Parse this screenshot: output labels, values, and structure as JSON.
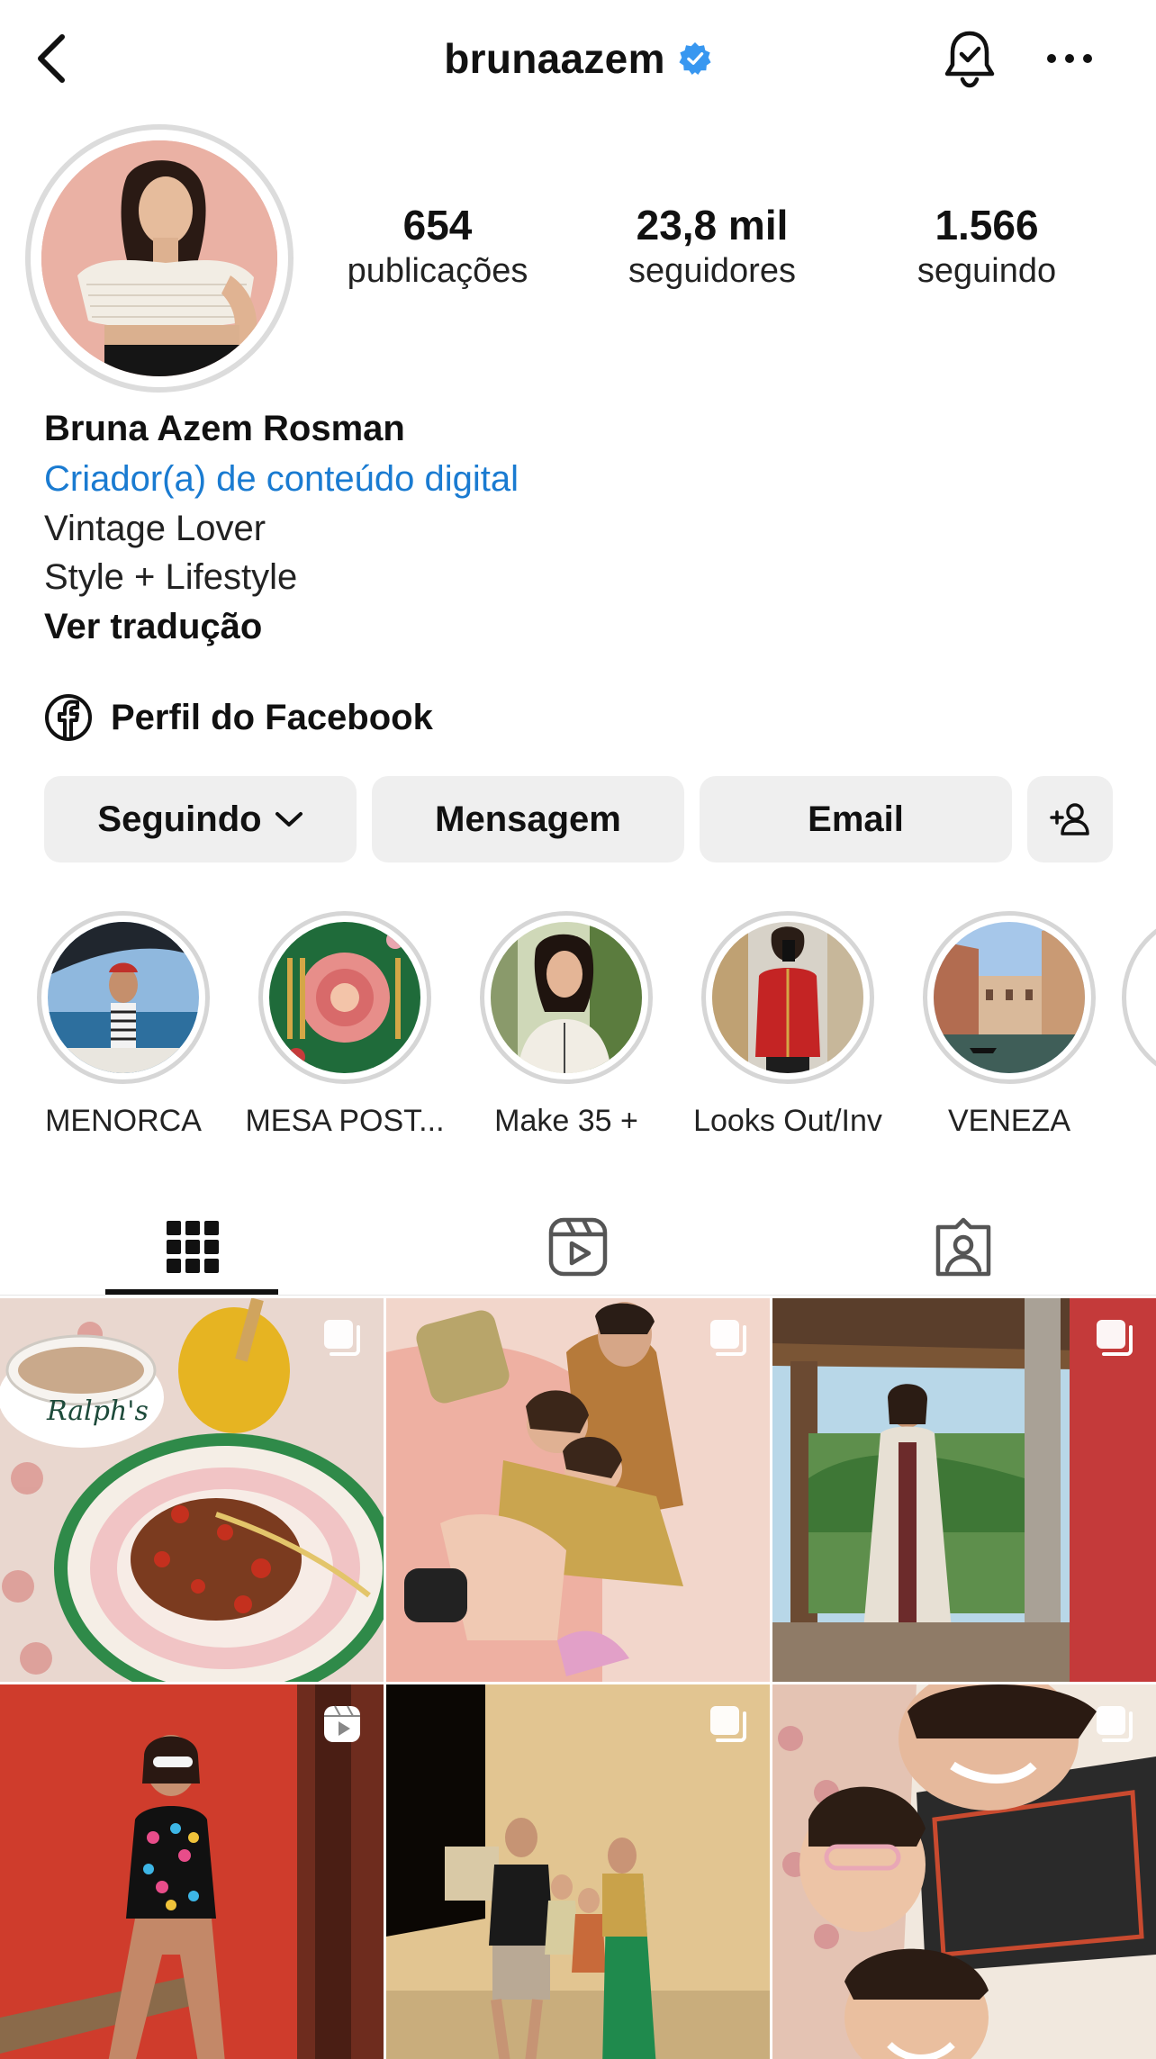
{
  "header": {
    "username": "brunaazem",
    "verified": true,
    "accent_color": "#3897f0"
  },
  "stats": [
    {
      "value": "654",
      "label": "publicações"
    },
    {
      "value": "23,8 mil",
      "label": "seguidores"
    },
    {
      "value": "1.566",
      "label": "seguindo"
    }
  ],
  "bio": {
    "name": "Bruna Azem Rosman",
    "category": "Criador(a) de conteúdo digital",
    "lines": [
      "Vintage Lover",
      "Style + Lifestyle"
    ],
    "translate": "Ver tradução",
    "category_color": "#1a7bd1"
  },
  "facebook": {
    "label": "Perfil do Facebook",
    "icon": "facebook-icon"
  },
  "actions": {
    "following": "Seguindo",
    "message": "Mensagem",
    "email": "Email",
    "add_person_icon": "add-person-icon"
  },
  "highlights": [
    {
      "label": "MENORCA"
    },
    {
      "label": "MESA POST..."
    },
    {
      "label": "Make 35 +"
    },
    {
      "label": "Looks Out/Inv"
    },
    {
      "label": "VENEZA"
    }
  ],
  "tabs": [
    {
      "name": "posts",
      "icon": "grid-icon",
      "active": true
    },
    {
      "name": "reels",
      "icon": "reels-icon",
      "active": false
    },
    {
      "name": "tagged",
      "icon": "tagged-icon",
      "active": false
    }
  ],
  "posts": [
    {
      "type": "carousel",
      "subject": "granola bowl and tea cup"
    },
    {
      "type": "carousel",
      "subject": "mother and children on sofa"
    },
    {
      "type": "carousel",
      "subject": "woman on porch"
    },
    {
      "type": "reel",
      "subject": "woman in sunglasses on bench"
    },
    {
      "type": "carousel",
      "subject": "family at night"
    },
    {
      "type": "carousel",
      "subject": "family selfie"
    }
  ]
}
